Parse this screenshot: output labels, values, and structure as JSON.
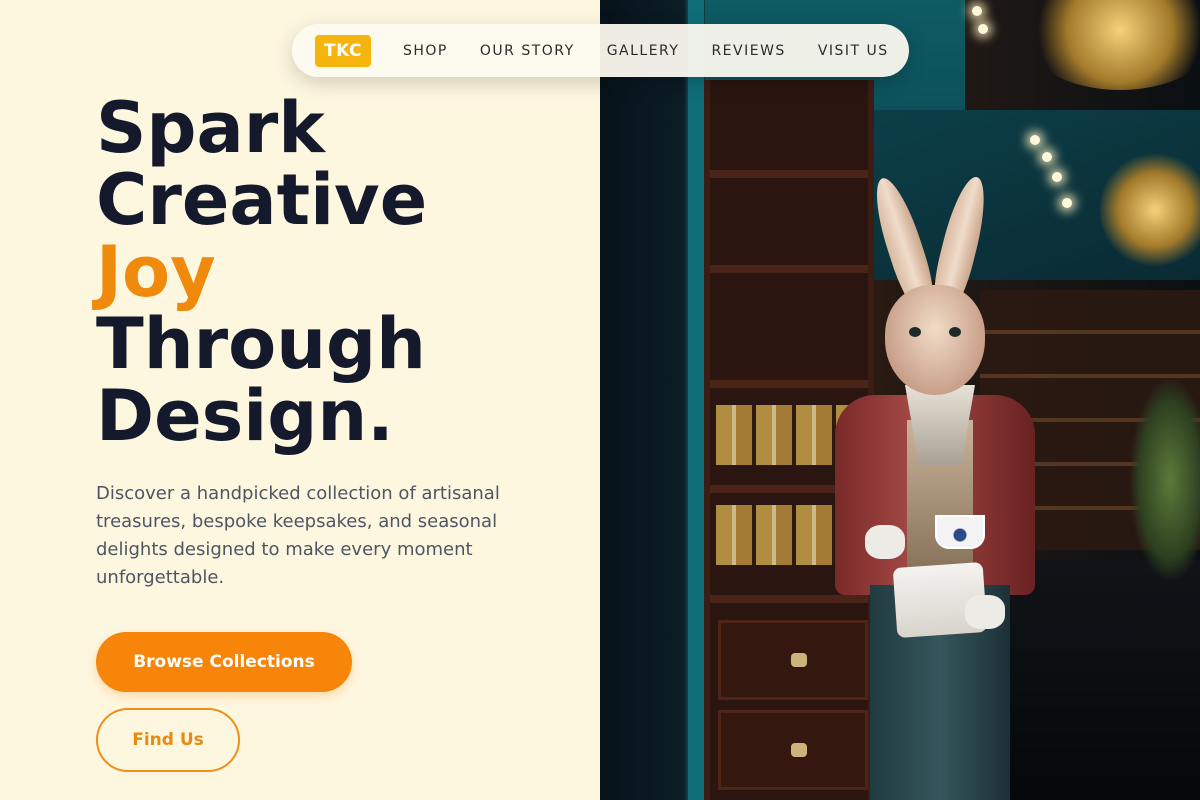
{
  "nav": {
    "logo": "TKC",
    "links": [
      "SHOP",
      "OUR STORY",
      "GALLERY",
      "REVIEWS",
      "VISIT US"
    ]
  },
  "hero": {
    "title_line1": "Spark",
    "title_line2": "Creative",
    "title_accent": "Joy",
    "title_line4": "Through",
    "title_line5": "Design.",
    "description": "Discover a handpicked collection of artisanal treasures, bespoke keepsakes, and seasonal delights designed to make every moment unforgettable.",
    "primary_button": "Browse Collections",
    "secondary_button": "Find Us"
  },
  "colors": {
    "accent": "#f6850a",
    "logo": "#f6b40e",
    "heading": "#141a2b",
    "background": "#fef7e0"
  }
}
